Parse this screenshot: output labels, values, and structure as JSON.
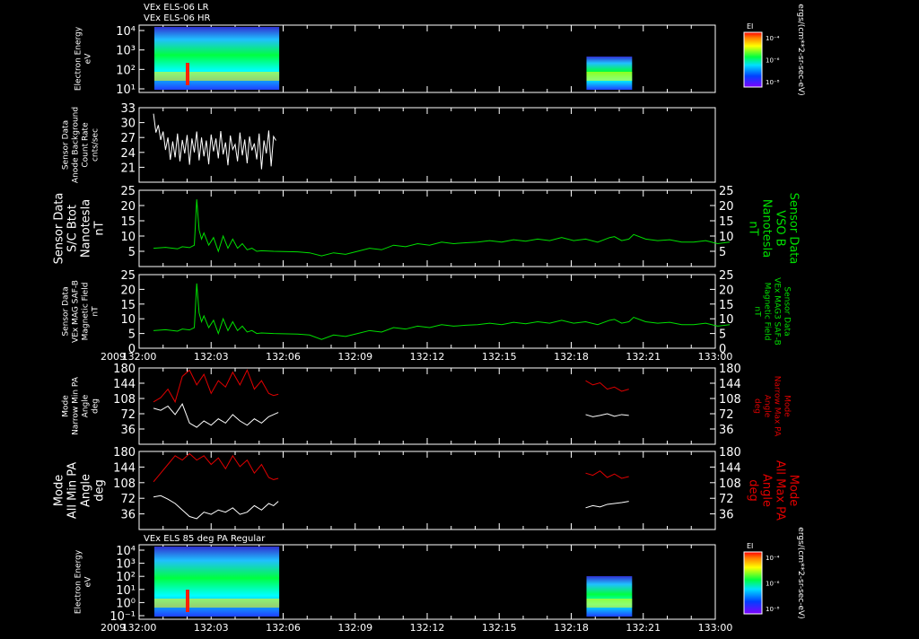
{
  "header": {
    "line1": "VEx ELS-06 LR",
    "line2": "VEx ELS-06 HR"
  },
  "colors": {
    "background": "#000000",
    "axis": "#ffffff",
    "green_trace": "#00e000",
    "red_trace": "#e00000",
    "white_trace": "#ffffff"
  },
  "time_axis": {
    "year": "2009",
    "ticks": [
      "132:00",
      "132:03",
      "132:06",
      "132:09",
      "132:12",
      "132:15",
      "132:18",
      "132:21",
      "133:00"
    ],
    "xlim": [
      0,
      24
    ]
  },
  "chart_data": [
    {
      "type": "heatmap",
      "id": "elec_energy_top",
      "ylabel_lines": [
        "Electron Energy",
        "eV"
      ],
      "scale": "log",
      "yticks": [
        "10⁴",
        "10³",
        "10²",
        "10¹"
      ],
      "colorbar": {
        "title": "EI",
        "ticks": [
          "10⁻⁴",
          "10⁻⁶",
          "10⁻⁸"
        ],
        "unit": "ergs/(cm**2-sr-sec-eV)"
      },
      "coverage_minutes": [
        [
          0.0,
          5.2
        ],
        [
          18.0,
          19.9
        ]
      ]
    },
    {
      "type": "line",
      "id": "anode_bg",
      "ylabel_lines": [
        "Sensor Data",
        "Anode Background",
        "Count Rate",
        "cnts/sec"
      ],
      "yticks": [
        "33",
        "30",
        "27",
        "24",
        "21"
      ],
      "ylim": [
        18,
        33
      ],
      "series": [
        {
          "color": "white",
          "x": [
            0.0,
            0.1,
            0.2,
            0.3,
            0.4,
            0.5,
            0.6,
            0.7,
            0.8,
            0.9,
            1.0,
            1.1,
            1.2,
            1.3,
            1.4,
            1.5,
            1.6,
            1.7,
            1.8,
            1.9,
            2.0,
            2.1,
            2.2,
            2.3,
            2.4,
            2.5,
            2.6,
            2.7,
            2.8,
            2.9,
            3.0,
            3.1,
            3.2,
            3.3,
            3.4,
            3.5,
            3.6,
            3.7,
            3.8,
            3.9,
            4.0,
            4.1,
            4.2,
            4.3,
            4.4,
            4.5,
            4.6,
            4.7,
            4.8,
            4.9,
            5.0,
            5.1
          ],
          "y": [
            31.8,
            28,
            29.5,
            26.5,
            28.2,
            24.5,
            27,
            22.5,
            26.2,
            23,
            27.8,
            22.2,
            26.5,
            23.8,
            27.5,
            21.5,
            26.8,
            24,
            28.2,
            22.4,
            27,
            23.2,
            26.4,
            21.6,
            27.6,
            24.2,
            26.8,
            22.8,
            28.3,
            23.6,
            26,
            21.4,
            27.4,
            24.6,
            25.6,
            22.2,
            28,
            23.4,
            26.6,
            21.8,
            27.2,
            24.4,
            25.8,
            22.6,
            27.8,
            20.6,
            26.4,
            23.8,
            28.4,
            21.2,
            27.2,
            26.4
          ]
        }
      ]
    },
    {
      "type": "line",
      "id": "sc_btot",
      "ylabel_lines": [
        "Sensor Data",
        "S/C Btot",
        "Nanotesla",
        "nT"
      ],
      "right_label_lines": [
        "Sensor Data",
        "VSO B",
        "Nanotesla",
        "nT"
      ],
      "yticks": [
        "25",
        "20",
        "15",
        "10",
        "5"
      ],
      "ylim": [
        0,
        25
      ],
      "series": [
        {
          "color": "green",
          "x": [
            0,
            0.5,
            1,
            1.2,
            1.5,
            1.7,
            1.8,
            1.9,
            2.0,
            2.1,
            2.3,
            2.5,
            2.7,
            2.9,
            3.1,
            3.3,
            3.5,
            3.7,
            3.9,
            4.1,
            4.3,
            4.5,
            5,
            6,
            6.5,
            7,
            7.5,
            8,
            8.5,
            9,
            9.5,
            10,
            10.5,
            11,
            11.5,
            12,
            12.5,
            13,
            13.5,
            14,
            14.5,
            15,
            15.5,
            16,
            16.5,
            17,
            17.5,
            18,
            18.5,
            19,
            19.2,
            19.5,
            19.8,
            20,
            20.5,
            21,
            21.5,
            22,
            22.5,
            23,
            23.5,
            24
          ],
          "y": [
            6,
            6.3,
            5.8,
            6.5,
            6.2,
            7,
            22,
            12,
            9,
            11,
            7,
            9.5,
            5,
            10,
            6,
            9,
            6,
            7.5,
            5.5,
            6,
            5,
            5.2,
            5,
            4.8,
            4.5,
            3.5,
            4.5,
            4,
            5,
            6,
            5.5,
            7,
            6.5,
            7.5,
            7,
            8,
            7.5,
            7.8,
            8,
            8.5,
            8,
            8.8,
            8.3,
            9,
            8.5,
            9.5,
            8.5,
            9,
            8,
            9.5,
            9.8,
            8.5,
            9,
            10.5,
            9,
            8.5,
            8.8,
            8,
            8,
            8.5,
            7.5,
            8
          ]
        }
      ]
    },
    {
      "type": "line",
      "id": "mag_saf",
      "ylabel_lines": [
        "Sensor Data",
        "VEx MAG SAF-B",
        "Magnetic Field",
        "nT"
      ],
      "right_label_lines": [
        "Sensor Data",
        "VEx MAG3 SAF-B",
        "Magnetic Field",
        "nT"
      ],
      "yticks": [
        "25",
        "20",
        "15",
        "10",
        "5",
        "0"
      ],
      "ylim": [
        0,
        25
      ],
      "series": [
        {
          "color": "green",
          "x": [
            0,
            0.5,
            1,
            1.2,
            1.5,
            1.7,
            1.8,
            1.9,
            2.0,
            2.1,
            2.3,
            2.5,
            2.7,
            2.9,
            3.1,
            3.3,
            3.5,
            3.7,
            3.9,
            4.1,
            4.3,
            4.5,
            5,
            6,
            6.5,
            7,
            7.5,
            8,
            8.5,
            9,
            9.5,
            10,
            10.5,
            11,
            11.5,
            12,
            12.5,
            13,
            13.5,
            14,
            14.5,
            15,
            15.5,
            16,
            16.5,
            17,
            17.5,
            18,
            18.5,
            19,
            19.2,
            19.5,
            19.8,
            20,
            20.5,
            21,
            21.5,
            22,
            22.5,
            23,
            23.5,
            24
          ],
          "y": [
            6,
            6.3,
            5.8,
            6.5,
            6.2,
            7,
            22,
            12,
            9,
            11,
            7,
            9.5,
            5,
            10,
            6,
            9,
            6,
            7.5,
            5.5,
            6,
            5,
            5.2,
            5,
            4.8,
            4.5,
            3,
            4.5,
            4,
            5,
            6,
            5.5,
            7,
            6.5,
            7.5,
            7,
            8,
            7.5,
            7.8,
            8,
            8.5,
            8,
            8.8,
            8.3,
            9,
            8.5,
            9.5,
            8.5,
            9,
            8,
            9.5,
            9.8,
            8.5,
            9,
            10.5,
            9,
            8.5,
            8.8,
            8,
            8,
            8.5,
            7.5,
            8
          ]
        }
      ]
    },
    {
      "type": "line",
      "id": "narrow_pa",
      "ylabel_lines": [
        "Mode",
        "Narrow Min PA",
        "Angle",
        "deg"
      ],
      "right_label_lines": [
        "Mode",
        "Narrow Max PA",
        "Angle",
        "deg"
      ],
      "yticks": [
        "180",
        "144",
        "108",
        "72",
        "36"
      ],
      "ylim": [
        0,
        180
      ],
      "series": [
        {
          "color": "red",
          "x": [
            0,
            0.3,
            0.6,
            0.9,
            1.2,
            1.5,
            1.8,
            2.1,
            2.4,
            2.7,
            3.0,
            3.3,
            3.6,
            3.9,
            4.2,
            4.5,
            4.8,
            5.0,
            5.2
          ],
          "y": [
            100,
            110,
            130,
            100,
            160,
            175,
            140,
            165,
            120,
            150,
            135,
            170,
            140,
            175,
            130,
            150,
            120,
            115,
            118
          ]
        },
        {
          "color": "white",
          "x": [
            0,
            0.3,
            0.6,
            0.9,
            1.2,
            1.5,
            1.8,
            2.1,
            2.4,
            2.7,
            3.0,
            3.3,
            3.6,
            3.9,
            4.2,
            4.5,
            4.8,
            5.0,
            5.2
          ],
          "y": [
            85,
            80,
            90,
            70,
            95,
            50,
            40,
            55,
            45,
            60,
            50,
            70,
            55,
            45,
            60,
            50,
            65,
            70,
            75
          ]
        },
        {
          "color": "red",
          "x": [
            18.0,
            18.3,
            18.6,
            18.9,
            19.2,
            19.5,
            19.8
          ],
          "y": [
            150,
            140,
            145,
            130,
            135,
            125,
            130
          ]
        },
        {
          "color": "white",
          "x": [
            18.0,
            18.3,
            18.6,
            18.9,
            19.2,
            19.5,
            19.8
          ],
          "y": [
            70,
            65,
            68,
            72,
            66,
            70,
            68
          ]
        }
      ]
    },
    {
      "type": "line",
      "id": "all_pa",
      "ylabel_lines": [
        "Mode",
        "All Min PA",
        "Angle",
        "deg"
      ],
      "right_label_lines": [
        "Mode",
        "All Max PA",
        "Angle",
        "deg"
      ],
      "yticks": [
        "180",
        "144",
        "108",
        "72",
        "36"
      ],
      "ylim": [
        0,
        180
      ],
      "series": [
        {
          "color": "red",
          "x": [
            0,
            0.3,
            0.6,
            0.9,
            1.2,
            1.5,
            1.8,
            2.1,
            2.4,
            2.7,
            3.0,
            3.3,
            3.6,
            3.9,
            4.2,
            4.5,
            4.8,
            5.0,
            5.2
          ],
          "y": [
            110,
            130,
            150,
            170,
            160,
            175,
            160,
            170,
            150,
            165,
            140,
            170,
            145,
            160,
            130,
            150,
            120,
            115,
            118
          ]
        },
        {
          "color": "white",
          "x": [
            0,
            0.3,
            0.6,
            0.9,
            1.2,
            1.5,
            1.8,
            2.1,
            2.4,
            2.7,
            3.0,
            3.3,
            3.6,
            3.9,
            4.2,
            4.5,
            4.8,
            5.0,
            5.2
          ],
          "y": [
            75,
            78,
            70,
            60,
            45,
            30,
            25,
            40,
            35,
            45,
            40,
            50,
            35,
            40,
            55,
            45,
            60,
            55,
            65
          ]
        },
        {
          "color": "red",
          "x": [
            18.0,
            18.3,
            18.6,
            18.9,
            19.2,
            19.5,
            19.8
          ],
          "y": [
            130,
            125,
            135,
            120,
            128,
            118,
            122
          ]
        },
        {
          "color": "white",
          "x": [
            18.0,
            18.3,
            18.6,
            18.9,
            19.2,
            19.5,
            19.8
          ],
          "y": [
            50,
            55,
            52,
            58,
            60,
            62,
            65
          ]
        }
      ]
    },
    {
      "type": "heatmap",
      "id": "elec_energy_bottom",
      "title": "VEx ELS 85 deg PA Regular",
      "ylabel_lines": [
        "Electron Energy",
        "eV"
      ],
      "scale": "log",
      "yticks": [
        "10⁴",
        "10³",
        "10²",
        "10¹",
        "10⁰",
        "10⁻¹"
      ],
      "colorbar": {
        "title": "EI",
        "ticks": [
          "10⁻⁴",
          "10⁻⁶",
          "10⁻⁸"
        ],
        "unit": "ergs/(cm**2-sr-sec-eV)"
      },
      "coverage_minutes": [
        [
          0.0,
          5.2
        ],
        [
          18.0,
          19.9
        ]
      ]
    }
  ]
}
